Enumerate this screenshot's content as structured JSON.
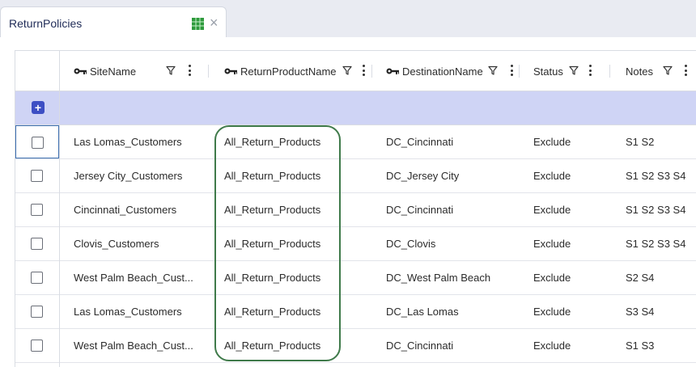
{
  "tab": {
    "title": "ReturnPolicies",
    "icon": "table-icon",
    "close_icon": "close-icon"
  },
  "columns": [
    {
      "label": "SiteName",
      "key": true
    },
    {
      "label": "ReturnProductName",
      "key": true
    },
    {
      "label": "DestinationName",
      "key": true
    },
    {
      "label": "Status",
      "key": false
    },
    {
      "label": "Notes",
      "key": false
    }
  ],
  "add_row": {
    "icon": "plus-icon"
  },
  "rows": [
    [
      "Las Lomas_Customers",
      "All_Return_Products",
      "DC_Cincinnati",
      "Exclude",
      "S1 S2"
    ],
    [
      "Jersey City_Customers",
      "All_Return_Products",
      "DC_Jersey City",
      "Exclude",
      "S1 S2 S3 S4"
    ],
    [
      "Cincinnati_Customers",
      "All_Return_Products",
      "DC_Cincinnati",
      "Exclude",
      "S1 S2 S3 S4"
    ],
    [
      "Clovis_Customers",
      "All_Return_Products",
      "DC_Clovis",
      "Exclude",
      "S1 S2 S3 S4"
    ],
    [
      "West Palm Beach_Cust...",
      "All_Return_Products",
      "DC_West Palm Beach",
      "Exclude",
      "S2 S4"
    ],
    [
      "Las Lomas_Customers",
      "All_Return_Products",
      "DC_Las Lomas",
      "Exclude",
      "S3 S4"
    ],
    [
      "West Palm Beach_Cust...",
      "All_Return_Products",
      "DC_Cincinnati",
      "Exclude",
      "S1 S3"
    ]
  ],
  "colors": {
    "accent": "#3d4fc4",
    "add_row_bg": "#cfd4f5",
    "highlight": "#3f7a4a",
    "topbar": "#e9ebf2"
  }
}
